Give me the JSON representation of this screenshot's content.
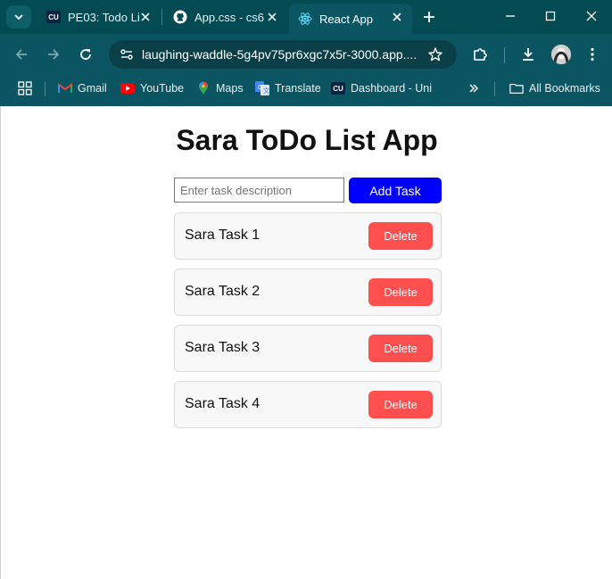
{
  "browser": {
    "tabs": [
      {
        "title": "PE03: Todo Li",
        "favicon": "cu-icon",
        "active": false
      },
      {
        "title": "App.css - cs6",
        "favicon": "github-icon",
        "active": false
      },
      {
        "title": "React App",
        "favicon": "react-icon",
        "active": true
      }
    ],
    "address": "laughing-waddle-5g4pv75pr6xgc7x5r-3000.app....",
    "bookmarks": [
      {
        "label": "Gmail",
        "icon": "gmail-icon"
      },
      {
        "label": "YouTube",
        "icon": "youtube-icon"
      },
      {
        "label": "Maps",
        "icon": "maps-icon"
      },
      {
        "label": "Translate",
        "icon": "translate-icon"
      },
      {
        "label": "Dashboard - Uni",
        "icon": "cu-icon"
      }
    ],
    "all_bookmarks_label": "All Bookmarks",
    "cu_badge": "CU",
    "colors": {
      "frame": "#034a52",
      "toolbar": "#0b5563",
      "omnibox": "#0a3f47"
    }
  },
  "app": {
    "title": "Sara ToDo List App",
    "input_placeholder": "Enter task description",
    "input_value": "",
    "add_button_label": "Add Task",
    "tasks": [
      {
        "text": "Sara Task 1",
        "delete_label": "Delete"
      },
      {
        "text": "Sara Task 2",
        "delete_label": "Delete"
      },
      {
        "text": "Sara Task 3",
        "delete_label": "Delete"
      },
      {
        "text": "Sara Task 4",
        "delete_label": "Delete"
      }
    ],
    "colors": {
      "add_button": "#0000ff",
      "delete_button": "#ff4f4f"
    }
  }
}
